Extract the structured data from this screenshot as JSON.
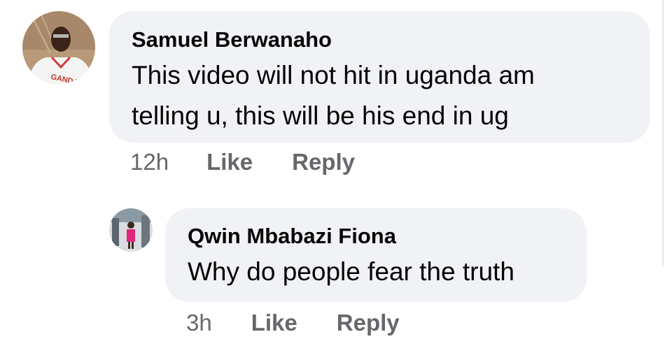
{
  "comments": [
    {
      "author": "Samuel Berwanaho",
      "text_lines": [
        "This video will not hit in uganda am",
        "telling u, this will be his end in ug"
      ],
      "time": "12h",
      "like_label": "Like",
      "reply_label": "Reply",
      "avatar_shirt_text": "GANDA"
    }
  ],
  "replies": [
    {
      "author": "Qwin Mbabazi Fiona",
      "text": "Why do people fear the truth",
      "time": "3h",
      "like_label": "Like",
      "reply_label": "Reply"
    }
  ],
  "colors": {
    "bubble": "#f0f2f5",
    "text": "#050505",
    "meta": "#65676b"
  }
}
